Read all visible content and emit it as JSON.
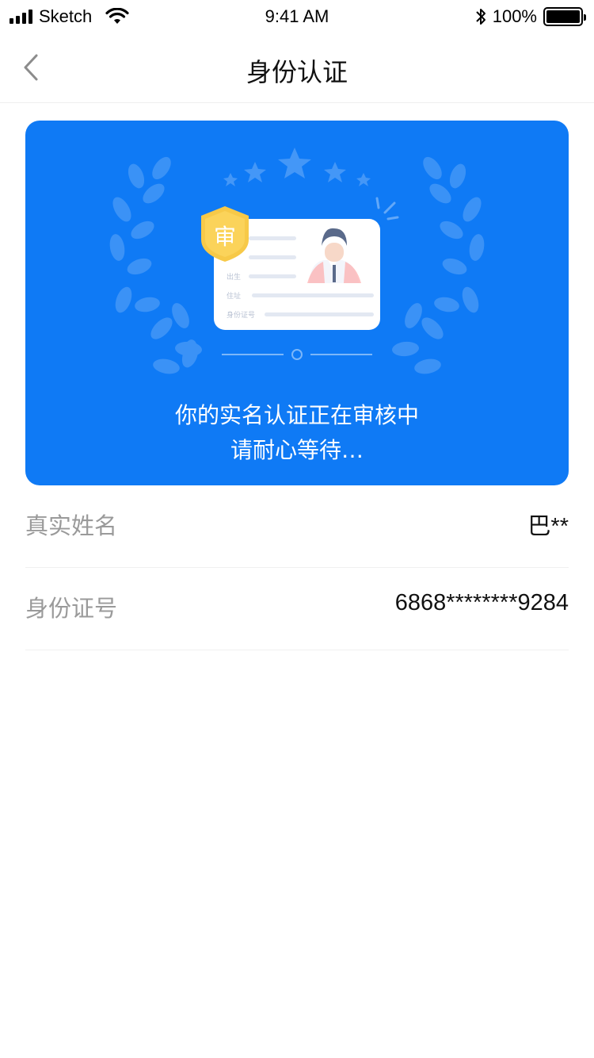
{
  "status_bar": {
    "carrier": "Sketch",
    "time": "9:41 AM",
    "battery_percent": "100%",
    "battery_level": 1.0
  },
  "nav": {
    "title": "身份认证",
    "back_icon": "chevron-left-icon"
  },
  "banner": {
    "illustration_badge": "审",
    "card_labels": [
      "出生",
      "住址",
      "身份证号"
    ],
    "message_line1": "你的实名认证正在审核中",
    "message_line2": "请耐心等待…",
    "colors": {
      "background": "#0f7af5",
      "badge": "#f7c948"
    }
  },
  "info": {
    "rows": [
      {
        "label": "真实姓名",
        "value": "巴**"
      },
      {
        "label": "身份证号",
        "value": "6868********9284"
      }
    ]
  }
}
